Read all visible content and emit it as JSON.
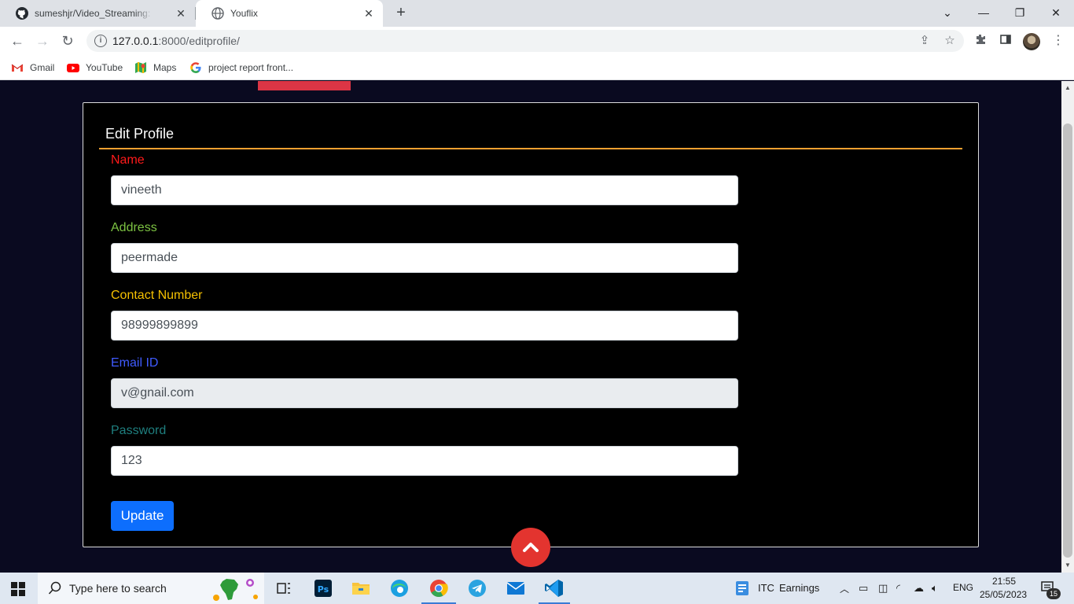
{
  "browser": {
    "tabs": [
      {
        "title": "sumeshjr/Video_Streaming: Onlin",
        "icon": "github-icon",
        "active": false
      },
      {
        "title": "Youflix",
        "icon": "globe-icon",
        "active": true
      }
    ],
    "url_host": "127.0.0.1",
    "url_rest": ":8000/editprofile/",
    "bookmarks": [
      {
        "label": "Gmail",
        "icon": "gmail-icon"
      },
      {
        "label": "YouTube",
        "icon": "youtube-icon"
      },
      {
        "label": "Maps",
        "icon": "maps-icon"
      },
      {
        "label": "project report front...",
        "icon": "google-icon"
      }
    ]
  },
  "form": {
    "title": "Edit Profile",
    "fields": [
      {
        "label": "Name",
        "value": "vineeth",
        "label_color": "#ff1a1a",
        "readonly": false
      },
      {
        "label": "Address",
        "value": "peermade",
        "label_color": "#7cc242",
        "readonly": false
      },
      {
        "label": "Contact Number",
        "value": "98999899899",
        "label_color": "#f5c000",
        "readonly": false
      },
      {
        "label": "Email ID",
        "value": "v@gnail.com",
        "label_color": "#3f5bff",
        "readonly": true
      },
      {
        "label": "Password",
        "value": "123",
        "label_color": "#1f7f7f",
        "readonly": false
      }
    ],
    "submit_label": "Update"
  },
  "taskbar": {
    "search_placeholder": "Type here to search",
    "stock_ticker": "ITC",
    "stock_text": "Earnings",
    "language": "ENG",
    "time": "21:55",
    "date": "25/05/2023",
    "notification_count": "15"
  },
  "colors": {
    "page_bg": "#0a0a20",
    "card_bg": "#000000",
    "title_rule": "#f0a030",
    "primary_button": "#0d6efd",
    "scroll_top_button": "#e3342f"
  }
}
